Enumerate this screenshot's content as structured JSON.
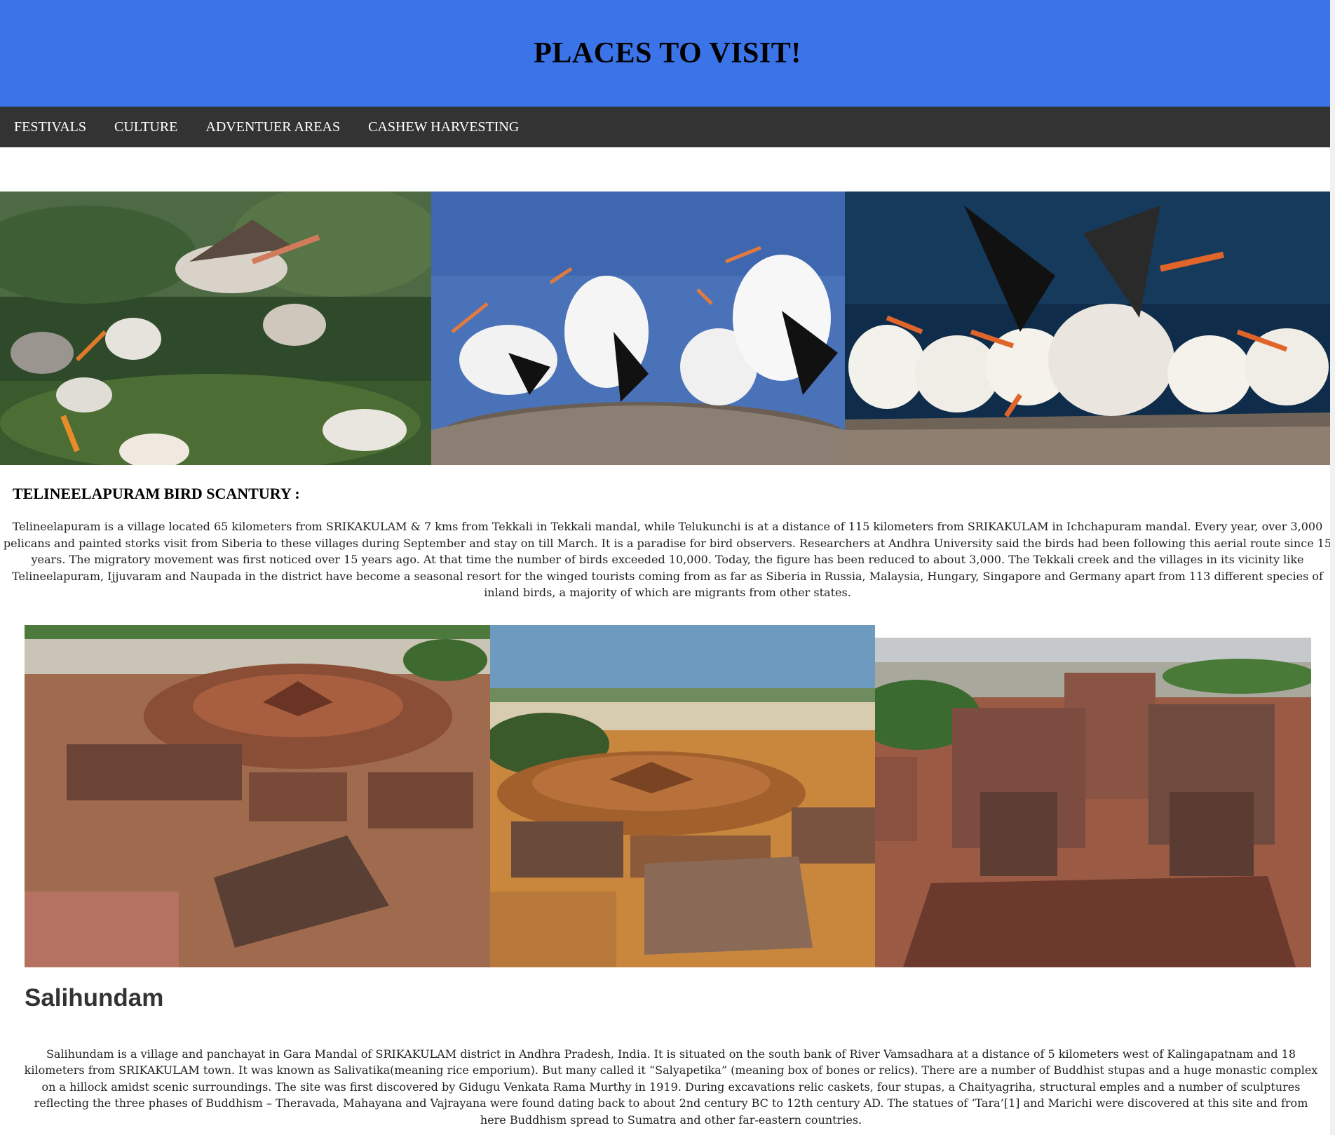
{
  "header": {
    "title": "PLACES TO VISIT!"
  },
  "nav": {
    "items": [
      {
        "label": "FESTIVALS"
      },
      {
        "label": "CULTURE"
      },
      {
        "label": "ADVENTUER AREAS"
      },
      {
        "label": "CASHEW HARVESTING"
      }
    ]
  },
  "bird_section": {
    "title": "TELINEELAPURAM BIRD SCANTURY :",
    "text": "Telineelapuram is a village located 65 kilometers from SRIKAKULAM & 7 kms from Tekkali in Tekkali mandal, while Telukunchi is at a distance of 115 kilometers from  SRIKAKULAM in Ichchapuram mandal. Every year, over 3,000 pelicans and painted storks visit from Siberia to these villages during September and stay on till March. It is a paradise for bird observers. Researchers at Andhra University said the birds had been following this aerial route since 15 years. The migratory movement was first noticed over 15 years ago. At that time the number of birds exceeded 10,000. Today, the figure has been reduced to about 3,000. The Tekkali creek and the villages in its vicinity like Telineelapuram, Ijjuvaram and Naupada in the district have become a seasonal resort for the winged tourists coming from as far as Siberia in Russia, Malaysia, Hungary, Singapore and Germany apart from 113 different species of inland birds, a majority of which are migrants from other states."
  },
  "salihundam_section": {
    "title": "Salihundam",
    "text": "Salihundam is a village and panchayat in Gara Mandal of SRIKAKULAM district in Andhra Pradesh, India. It is situated on the south bank of River Vamsadhara at a distance of 5 kilometers west of Kalingapatnam and 18 kilometers from SRIKAKULAM town. It was known as Salivatika(meaning rice emporium). But many called it “Salyapetika” (meaning box of bones or relics). There are a number of Buddhist stupas and a huge monastic complex on a hillock amidst scenic surroundings. The site was first discovered by Gidugu Venkata Rama Murthy in 1919. During excavations relic caskets, four stupas, a Chaityagriha, structural emples and a number of sculptures reflecting the three phases of Buddhism – Theravada, Mahayana and Vajrayana were found dating back to about 2nd century BC to 12th century AD. The statues of ‘Tara’[1] and Marichi were discovered at this site and from here Buddhism spread to Sumatra and other far-eastern countries."
  },
  "colors": {
    "header_bg": "#3a74e8",
    "nav_bg": "#333333",
    "nav_text": "#ffffff"
  }
}
